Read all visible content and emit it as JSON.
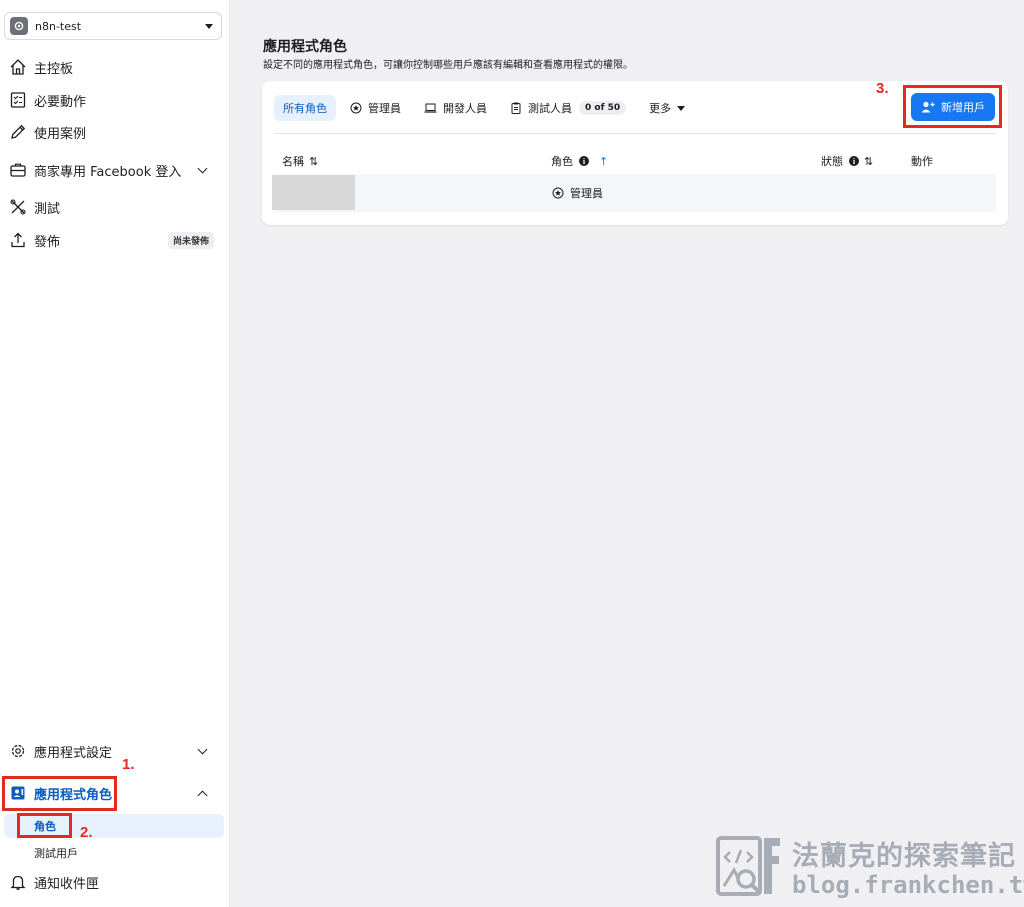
{
  "app_selector": {
    "name": "n8n-test"
  },
  "sidebar": {
    "items": [
      {
        "label": "主控板",
        "icon": "home-icon"
      },
      {
        "label": "必要動作",
        "icon": "checklist-icon"
      },
      {
        "label": "使用案例",
        "icon": "pencil-icon"
      },
      {
        "label": "商家專用 Facebook 登入",
        "icon": "briefcase-icon"
      },
      {
        "label": "測試",
        "icon": "tools-icon"
      },
      {
        "label": "發佈",
        "icon": "upload-icon",
        "badge": "尚未發佈"
      }
    ],
    "bottom_items": [
      {
        "label": "應用程式設定",
        "icon": "gear-icon"
      },
      {
        "label": "應用程式角色",
        "icon": "roles-icon"
      }
    ],
    "sub_items": [
      {
        "label": "角色"
      },
      {
        "label": "測試用戶"
      }
    ],
    "notifications": {
      "label": "通知收件匣",
      "icon": "bell-icon"
    }
  },
  "annotations": {
    "one": "1.",
    "two": "2.",
    "three": "3.",
    "color": "#e4291d"
  },
  "main": {
    "title": "應用程式角色",
    "description": "設定不同的應用程式角色，可讓你控制哪些用戶應該有編輯和查看應用程式的權限。",
    "tabs": [
      {
        "label": "所有角色"
      },
      {
        "label": "管理員"
      },
      {
        "label": "開發人員"
      },
      {
        "label": "測試人員",
        "count": "0 of 50"
      },
      {
        "label": "更多"
      }
    ],
    "add_user_label": "新增用戶",
    "columns": {
      "name": "名稱",
      "role": "角色",
      "status": "狀態",
      "action": "動作"
    },
    "rows": [
      {
        "role": "管理員"
      }
    ]
  },
  "watermark": {
    "title": "法蘭克的探索筆記",
    "url": "blog.frankchen.tw"
  },
  "colors": {
    "accent": "#1877f2",
    "annotation": "#e4291d"
  }
}
